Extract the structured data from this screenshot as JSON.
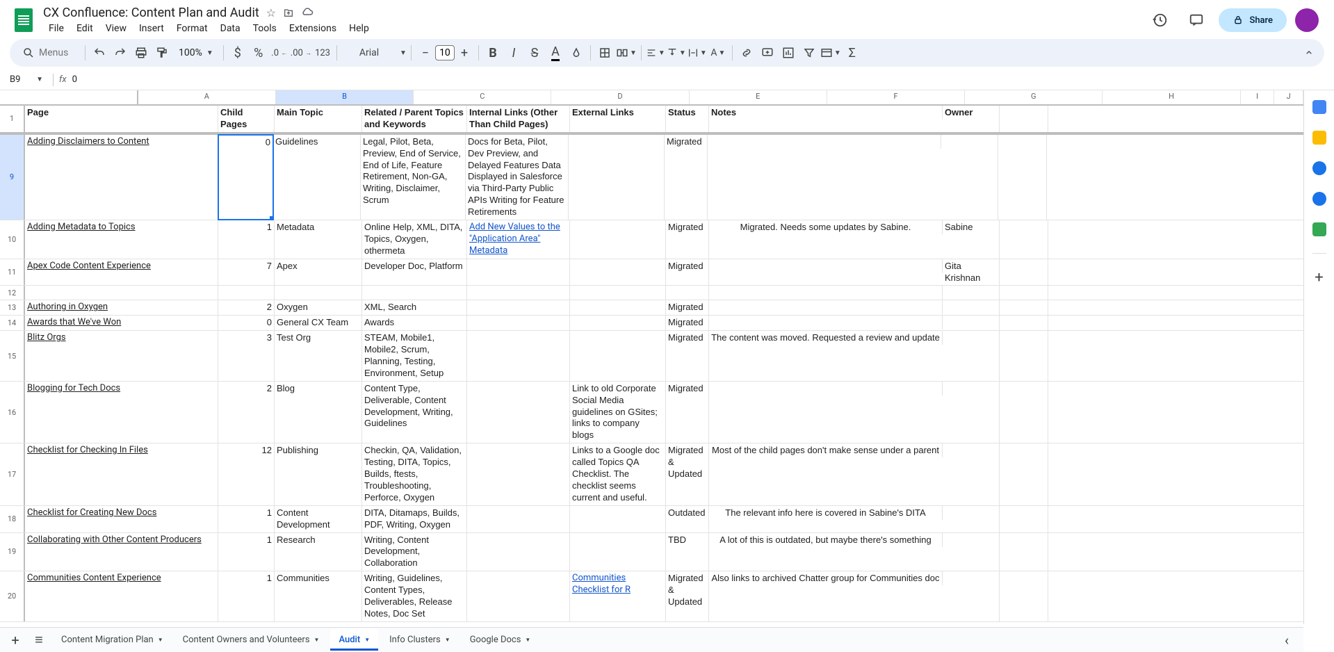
{
  "doc_title": "CX Confluence: Content Plan and Audit",
  "menus": [
    "File",
    "Edit",
    "View",
    "Insert",
    "Format",
    "Data",
    "Tools",
    "Extensions",
    "Help"
  ],
  "share_label": "Share",
  "search_placeholder": "Menus",
  "zoom": "100%",
  "font_name": "Arial",
  "font_size": "10",
  "name_box": "B9",
  "formula": "0",
  "columns": [
    "A",
    "B",
    "C",
    "D",
    "E",
    "F",
    "G",
    "H",
    "I",
    "J"
  ],
  "headers": {
    "A": "Page",
    "B": "Child Pages",
    "C": "Main Topic",
    "D": "Related / Parent Topics and Keywords",
    "E": "Internal Links (Other Than Child Pages)",
    "F": "External Links",
    "G": "Status",
    "H": "Notes",
    "I": "Owner",
    "J": ""
  },
  "rows": [
    {
      "n": "9",
      "A": "Adding Disclaimers to Content",
      "Alink": true,
      "B": "0",
      "Bsel": true,
      "C": "Guidelines",
      "D": "Legal, Pilot, Beta, Preview, End of Service, End of Life, Feature Retirement, Non-GA, Writing, Disclaimer, Scrum",
      "E": "Docs for Beta, Pilot, Dev Preview, and Delayed Features\nData Displayed in Salesforce via Third-Party Public APIs\nWriting for Feature Retirements",
      "G": "Migrated"
    },
    {
      "n": "10",
      "A": "Adding Metadata to Topics",
      "Alink": true,
      "B": "1",
      "C": "Metadata",
      "D": "Online Help, XML, DITA, Topics, Oxygen, othermeta",
      "E": "Add New Values to the \"Application Area\" Metadata",
      "Elink": true,
      "G": "Migrated",
      "H": "Migrated. Needs some updates by Sabine.",
      "I": "Sabine"
    },
    {
      "n": "11",
      "A": "Apex Code Content Experience",
      "Alink": true,
      "B": "7",
      "C": "Apex",
      "D": "Developer Doc, Platform",
      "G": "Migrated",
      "I": "Gita Krishnan"
    },
    {
      "n": "12"
    },
    {
      "n": "13",
      "A": "Authoring in Oxygen",
      "Alink": true,
      "B": "2",
      "C": "Oxygen",
      "D": "XML, Search",
      "G": "Migrated"
    },
    {
      "n": "14",
      "A": "Awards that We've Won",
      "Alink": true,
      "B": "0",
      "C": "General CX Team",
      "D": "Awards",
      "G": "Migrated"
    },
    {
      "n": "15",
      "A": "Blitz Orgs",
      "Alink": true,
      "B": "3",
      "C": "Test Org",
      "D": "STEAM, Mobile1, Mobile2, Scrum, Planning, Testing, Environment, Setup",
      "G": "Migrated",
      "H": "The content was moved. Requested a review and update of the information."
    },
    {
      "n": "16",
      "A": "Blogging for Tech Docs",
      "Alink": true,
      "B": "2",
      "C": "Blog",
      "D": "Content Type, Deliverable, Content Development, Writing, Guidelines",
      "F": "Link to old Corporate Social Media guidelines on GSites; links to company blogs",
      "G": "Migrated"
    },
    {
      "n": "17",
      "A": "Checklist for Checking In Files",
      "Alink": true,
      "B": "12",
      "C": "Publishing",
      "D": "Checkin, QA, Validation, Testing, DITA, Topics, Builds, ftests, Troubleshooting, Perforce, Oxygen",
      "F": "Links to a Google doc called Topics QA Checklist. The checklist seems current and useful.",
      "G": "Migrated & Updated",
      "H": "Most of the child pages don't make sense under a parent topic that is a \"checklist.\"  All of these child pages need to be evaluated to see what's current. Then the content from those pages should be moved into categories that make sense. (For example, one of the child pages contains information about writing impementation guides. Obviously that should be grouped with our other content types and deliverables; not under a parent topic purporting to be a checklist. There are also several pages about creating help links for different types of doc sets.)"
    },
    {
      "n": "18",
      "A": "Checklist for Creating New Docs",
      "Alink": true,
      "B": "1",
      "C": "Content Development",
      "D": "DITA, Ditamaps, Builds, PDF, Writing, Oxygen",
      "G": "Outdated",
      "H": "The relevant info here is covered in Sabine's DITA guidelines for guides/bundles on Confluence."
    },
    {
      "n": "19",
      "A": "Collaborating with Other Content Producers",
      "Alink": true,
      "B": "1",
      "C": "Research",
      "D": "Writing, Content Development, Collaboration",
      "G": "TBD",
      "H": "A lot of this is outdated, but maybe there's something salvageable. It's a good idea. There's also a child page with some notes about an old pre-170 Training/Doc collaboration; have there been any recent collabs between the two groups?"
    },
    {
      "n": "20",
      "A": "Communities Content Experience",
      "Alink": true,
      "B": "1",
      "C": "Communities",
      "D": "Writing, Guidelines, Content Types, Deliverables, Release Notes, Doc Set",
      "F": "Communities Checklist for R",
      "Flink": true,
      "G": "Migrated & Updated",
      "H": "Also links to archived Chatter group for Communities doc"
    }
  ],
  "sheets": [
    "Content Migration Plan",
    "Content Owners and Volunteers",
    "Audit",
    "Info Clusters",
    "Google Docs"
  ],
  "active_sheet": 2
}
